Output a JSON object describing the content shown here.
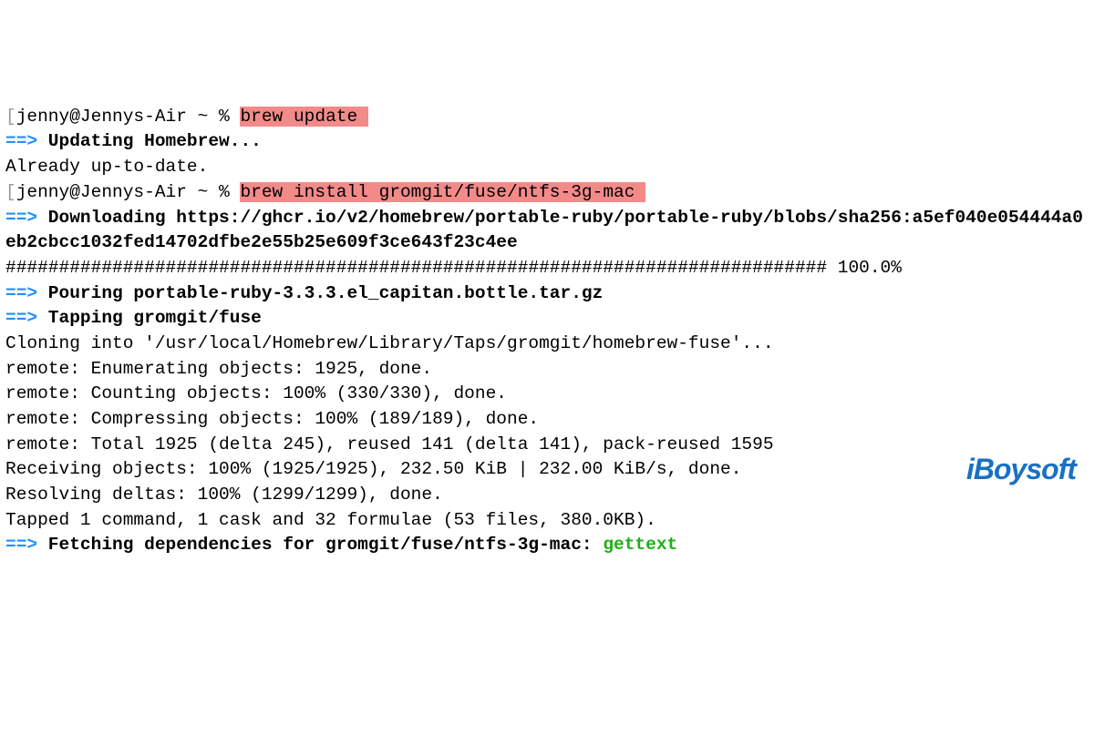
{
  "colors": {
    "arrow_blue": "#1e90ff",
    "highlight_bg": "#f38a8a",
    "green_text": "#1db117",
    "text": "#000000",
    "dim": "#999999"
  },
  "terminal": {
    "lines": [
      {
        "type": "prompt",
        "bracket_left": "[",
        "prompt": "jenny@Jennys-Air ~ % ",
        "command": "brew update",
        "trailing": " "
      },
      {
        "type": "arrow_bold",
        "arrow": "==>",
        "text": " Updating Homebrew..."
      },
      {
        "type": "plain",
        "text": "Already up-to-date."
      },
      {
        "type": "prompt",
        "bracket_left": "[",
        "prompt": "jenny@Jennys-Air ~ % ",
        "command": "brew install gromgit/fuse/ntfs-3g-mac",
        "trailing": " "
      },
      {
        "type": "arrow_bold",
        "arrow": "==>",
        "text": " Downloading https://ghcr.io/v2/homebrew/portable-ruby/portable-ruby/blobs/sha256:a5ef040e054444a0eb2cbcc1032fed14702dfbe2e55b25e609f3ce643f23c4ee"
      },
      {
        "type": "plain",
        "text": "############################################################################# 100.0%"
      },
      {
        "type": "arrow_bold",
        "arrow": "==>",
        "text": " Pouring portable-ruby-3.3.3.el_capitan.bottle.tar.gz"
      },
      {
        "type": "arrow_bold",
        "arrow": "==>",
        "text": " Tapping gromgit/fuse"
      },
      {
        "type": "plain",
        "text": "Cloning into '/usr/local/Homebrew/Library/Taps/gromgit/homebrew-fuse'..."
      },
      {
        "type": "plain",
        "text": "remote: Enumerating objects: 1925, done."
      },
      {
        "type": "plain",
        "text": "remote: Counting objects: 100% (330/330), done."
      },
      {
        "type": "plain",
        "text": "remote: Compressing objects: 100% (189/189), done."
      },
      {
        "type": "plain",
        "text": "remote: Total 1925 (delta 245), reused 141 (delta 141), pack-reused 1595"
      },
      {
        "type": "plain",
        "text": "Receiving objects: 100% (1925/1925), 232.50 KiB | 232.00 KiB/s, done."
      },
      {
        "type": "plain",
        "text": "Resolving deltas: 100% (1299/1299), done."
      },
      {
        "type": "plain",
        "text": "Tapped 1 command, 1 cask and 32 formulae (53 files, 380.0KB)."
      },
      {
        "type": "arrow_bold_green",
        "arrow": "==>",
        "text": " Fetching dependencies for gromgit/fuse/ntfs-3g-mac: ",
        "green": "gettext"
      }
    ]
  },
  "watermark": "iBoysoft"
}
